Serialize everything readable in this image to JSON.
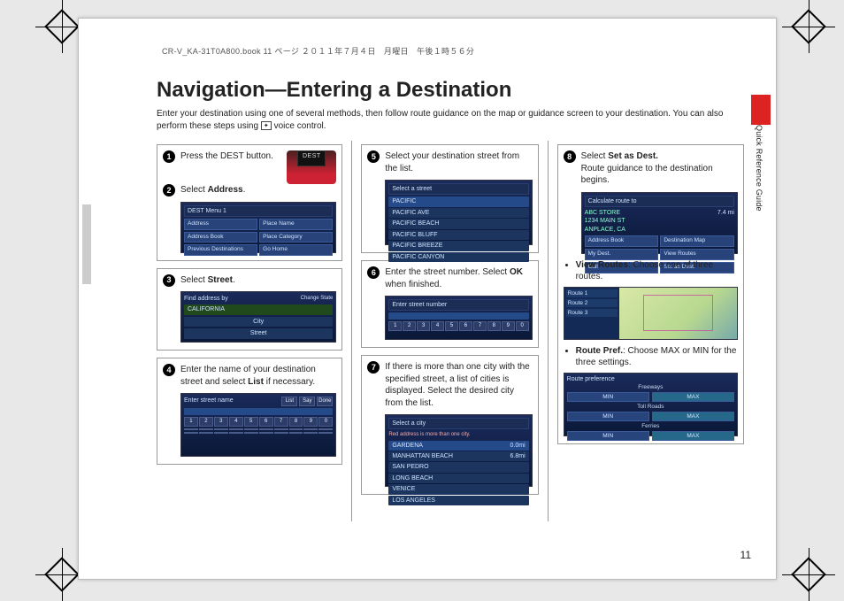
{
  "header_line": "CR-V_KA-31T0A800.book  11 ページ  ２０１１年７月４日　月曜日　午後１時５６分",
  "title": "Navigation—Entering a Destination",
  "intro_before": "Enter your destination using one of several methods, then follow route guidance on the map or guidance screen to your destination. You can also perform these steps using ",
  "intro_after": " voice control.",
  "side_label": "Quick Reference Guide",
  "page_number": "11",
  "steps": {
    "s1": "Press the DEST button.",
    "s2a": "Select ",
    "s2b": "Address",
    "s2c": ".",
    "s3a": "Select ",
    "s3b": "Street",
    "s3c": ".",
    "s4a": "Enter the name of your destination street and select ",
    "s4b": "List",
    "s4c": " if necessary.",
    "s5": "Select your destination street from the list.",
    "s6a": "Enter the street number. Select ",
    "s6b": "OK",
    "s6c": " when finished.",
    "s7": "If there is more than one city with the specified street, a list of cities is displayed. Select the desired city from the list.",
    "s8a": "Select ",
    "s8b": "Set as Dest.",
    "s8c": "",
    "s8_sub": "Route guidance to the destination begins."
  },
  "bullets": {
    "b1a": "View Routes",
    "b1b": ": Choose one of three routes.",
    "b2a": "Route Pref.",
    "b2b": ": Choose MAX or MIN for the three settings."
  },
  "shots": {
    "dest_btn": "DEST",
    "dest_menu_title": "DEST Menu 1",
    "dest_menu": [
      "Address",
      "Place Name",
      "Address Book",
      "Place Category",
      "Previous Destinations",
      "Go Home"
    ],
    "find_addr_title": "Find address by",
    "find_addr_state": "CALIFORNIA",
    "find_addr_btns": [
      "City",
      "Street"
    ],
    "enter_street_title": "Enter street name",
    "enter_street_side": [
      "List",
      "Say",
      "Done"
    ],
    "keypad_digits": [
      "1",
      "2",
      "3",
      "4",
      "5",
      "6",
      "7",
      "8",
      "9",
      "0"
    ],
    "select_street_title": "Select a street",
    "streets": [
      "PACIFIC",
      "PACIFIC AVE",
      "PACIFIC BEACH",
      "PACIFIC BLUFF",
      "PACIFIC BREEZE",
      "PACIFIC CANYON"
    ],
    "enter_number_title": "Enter street number",
    "select_city_title": "Select a city",
    "select_city_sub": "Red address is more than one city.",
    "cities": [
      "GARDENA",
      "MANHATTAN BEACH",
      "SAN PEDRO",
      "LONG BEACH",
      "VENICE",
      "LOS ANGELES"
    ],
    "city_dist": [
      "0.0mi",
      "6.8mi",
      "",
      "",
      "",
      ""
    ],
    "calc_title": "Calculate route to",
    "calc_lines": [
      "ABC STORE",
      "1234 MAIN ST",
      "ANPLACE, CA",
      "7.4 mi"
    ],
    "calc_btns": [
      "Address Book",
      "Destination Map",
      "My Dest.",
      "View Routes",
      "Call",
      "Set as Dest."
    ],
    "map_routes": [
      "Route 1",
      "Route 2",
      "Route 3"
    ],
    "pref_title": "Route preference",
    "pref_rows": [
      "Freeways",
      "Toll Roads",
      "Ferries"
    ],
    "pref_min": "MIN",
    "pref_max": "MAX",
    "change_state": "Change State"
  }
}
